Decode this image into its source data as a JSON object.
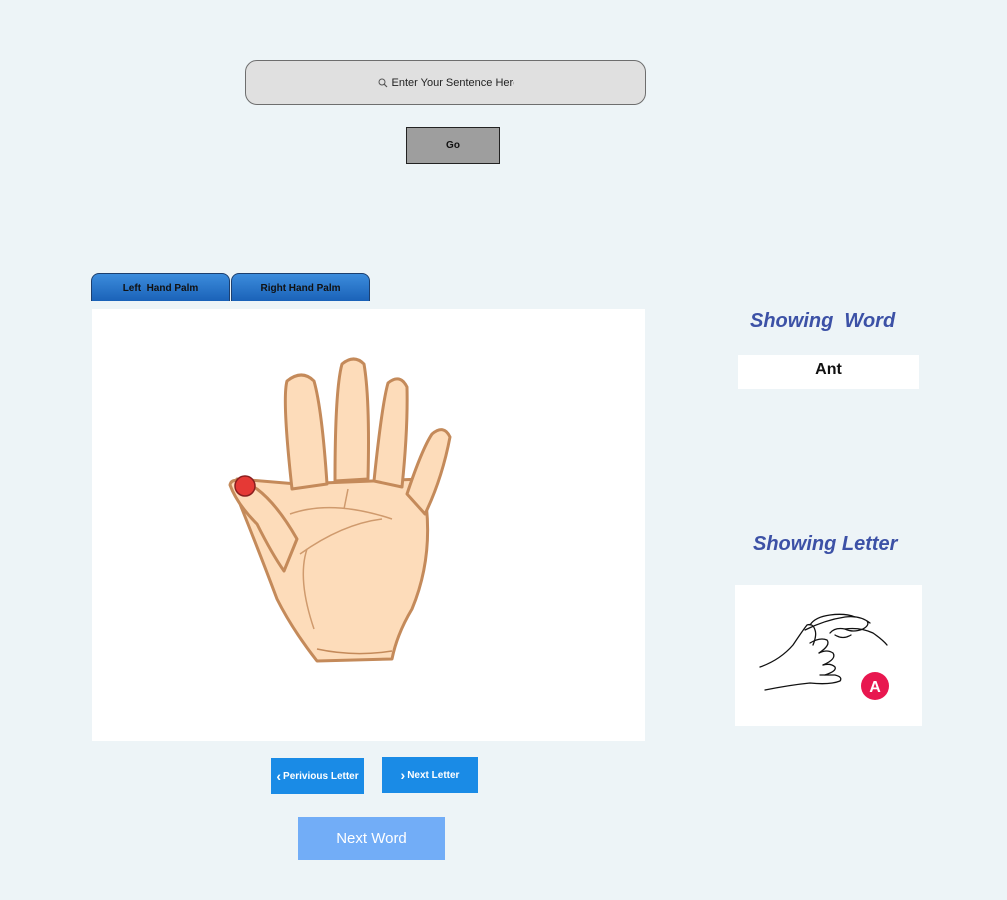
{
  "search": {
    "placeholder": "Enter Your Sentence Here",
    "icon": "search-icon"
  },
  "go_button": {
    "label": "Go"
  },
  "tabs": [
    {
      "label": "Left  Hand Palm"
    },
    {
      "label": "Right Hand Palm"
    }
  ],
  "palm": {
    "image": "open-hand-palm",
    "marker": "red-dot-thumb-tip",
    "marker_color": "#e53935"
  },
  "navigation": {
    "previous_label": "Perivious Letter",
    "next_label": "Next Letter",
    "next_word_label": "Next Word"
  },
  "showing_word": {
    "heading": "Showing  Word",
    "value": "Ant"
  },
  "showing_letter": {
    "heading": "Showing Letter",
    "badge": "A",
    "badge_color": "#e8174f",
    "image": "sign-language-letter-a"
  },
  "colors": {
    "background": "#edf4f7",
    "tab_blue": "#2474d0",
    "button_blue": "#1a8be6",
    "next_word_blue": "#72adf7",
    "heading_blue": "#3c51a6"
  }
}
